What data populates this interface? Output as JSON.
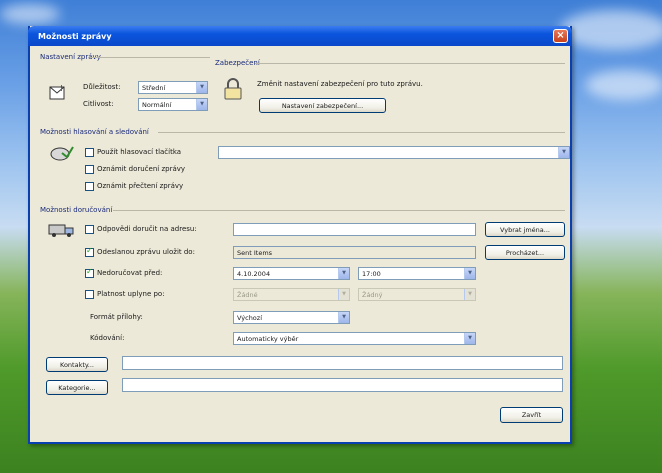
{
  "window": {
    "title": "Možnosti zprávy",
    "close_glyph": "×"
  },
  "message_settings": {
    "group_title": "Nastavení zprávy",
    "importance": {
      "label": "Důležitost:",
      "value": "Střední"
    },
    "sensitivity": {
      "label": "Citlivost:",
      "value": "Normální"
    }
  },
  "security": {
    "group_title": "Zabezpečení",
    "description": "Změnit nastavení zabezpečení pro tuto zprávu.",
    "settings_button": "Nastavení zabezpečení..."
  },
  "voting": {
    "group_title": "Možnosti hlasování a sledování",
    "use_voting": {
      "label": "Použít hlasovací tlačítka",
      "checked": false
    },
    "delivery_receipt": {
      "label": "Oznámit doručení zprávy",
      "checked": false
    },
    "read_receipt": {
      "label": "Oznámit přečtení zprávy",
      "checked": false
    },
    "voting_value": ""
  },
  "delivery": {
    "group_title": "Možnosti doručování",
    "replies_to": {
      "label": "Odpovědi doručit na adresu:",
      "checked": false,
      "value": ""
    },
    "select_names_button": "Vybrat jména...",
    "save_sent": {
      "label": "Odeslanou zprávu uložit do:",
      "checked": true,
      "value": "Sent Items"
    },
    "browse_button": "Procházet...",
    "do_not_deliver": {
      "label": "Nedoručovat před:",
      "checked": true,
      "date": "4.10.2004",
      "time": "17:00"
    },
    "expires": {
      "label": "Platnost uplyne po:",
      "checked": false,
      "date": "Žádné",
      "time": "Žádný"
    },
    "attachment_format": {
      "label": "Formát přílohy:",
      "value": "Výchozí"
    },
    "encoding": {
      "label": "Kódování:",
      "value": "Automaticky výběr"
    }
  },
  "contacts": {
    "button": "Kontakty...",
    "value": ""
  },
  "categories": {
    "button": "Kategorie...",
    "value": ""
  },
  "close_button": "Zavřít",
  "colors": {
    "title_bar": "#0a55dd",
    "dialog_bg": "#ece9d8",
    "check": "#21a121"
  }
}
